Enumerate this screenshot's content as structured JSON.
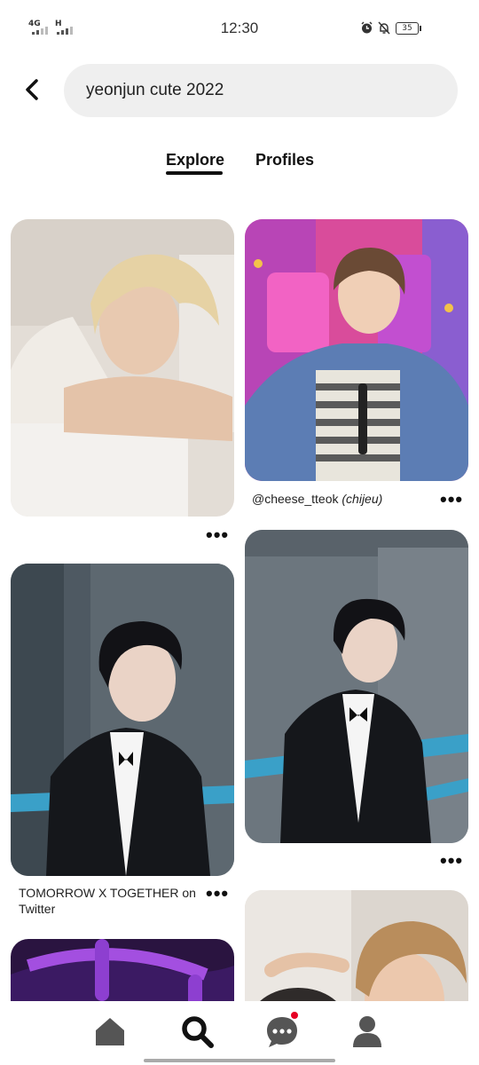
{
  "status_bar": {
    "network_1": "4G",
    "network_2": "H",
    "time": "12:30",
    "battery": "35",
    "icons": [
      "alarm-icon",
      "bell-off-icon",
      "battery-icon"
    ]
  },
  "search": {
    "query": "yeonjun cute 2022",
    "back_icon": "chevron-left-icon"
  },
  "tabs": [
    {
      "label": "Explore",
      "active": true
    },
    {
      "label": "Profiles",
      "active": false
    }
  ],
  "pins": [
    {
      "id": "pin-1",
      "caption": ""
    },
    {
      "id": "pin-2",
      "caption_handle": "@cheese_tteok",
      "caption_extra": "(chijeu)"
    },
    {
      "id": "pin-3",
      "caption_line1": "TOMORROW X TOGETHER on",
      "caption_line2": "Twitter"
    },
    {
      "id": "pin-4",
      "caption": ""
    },
    {
      "id": "pin-5",
      "caption": ""
    },
    {
      "id": "pin-6",
      "caption": ""
    }
  ],
  "more_label": "•••",
  "bottom_nav": [
    {
      "name": "home",
      "icon": "home-icon"
    },
    {
      "name": "search",
      "icon": "search-icon",
      "active": true
    },
    {
      "name": "messages",
      "icon": "chat-bubble-icon",
      "notification": true
    },
    {
      "name": "profile",
      "icon": "person-icon"
    }
  ],
  "colors": {
    "accent": "#e60023",
    "search_bg": "#efefef",
    "text": "#111111"
  }
}
